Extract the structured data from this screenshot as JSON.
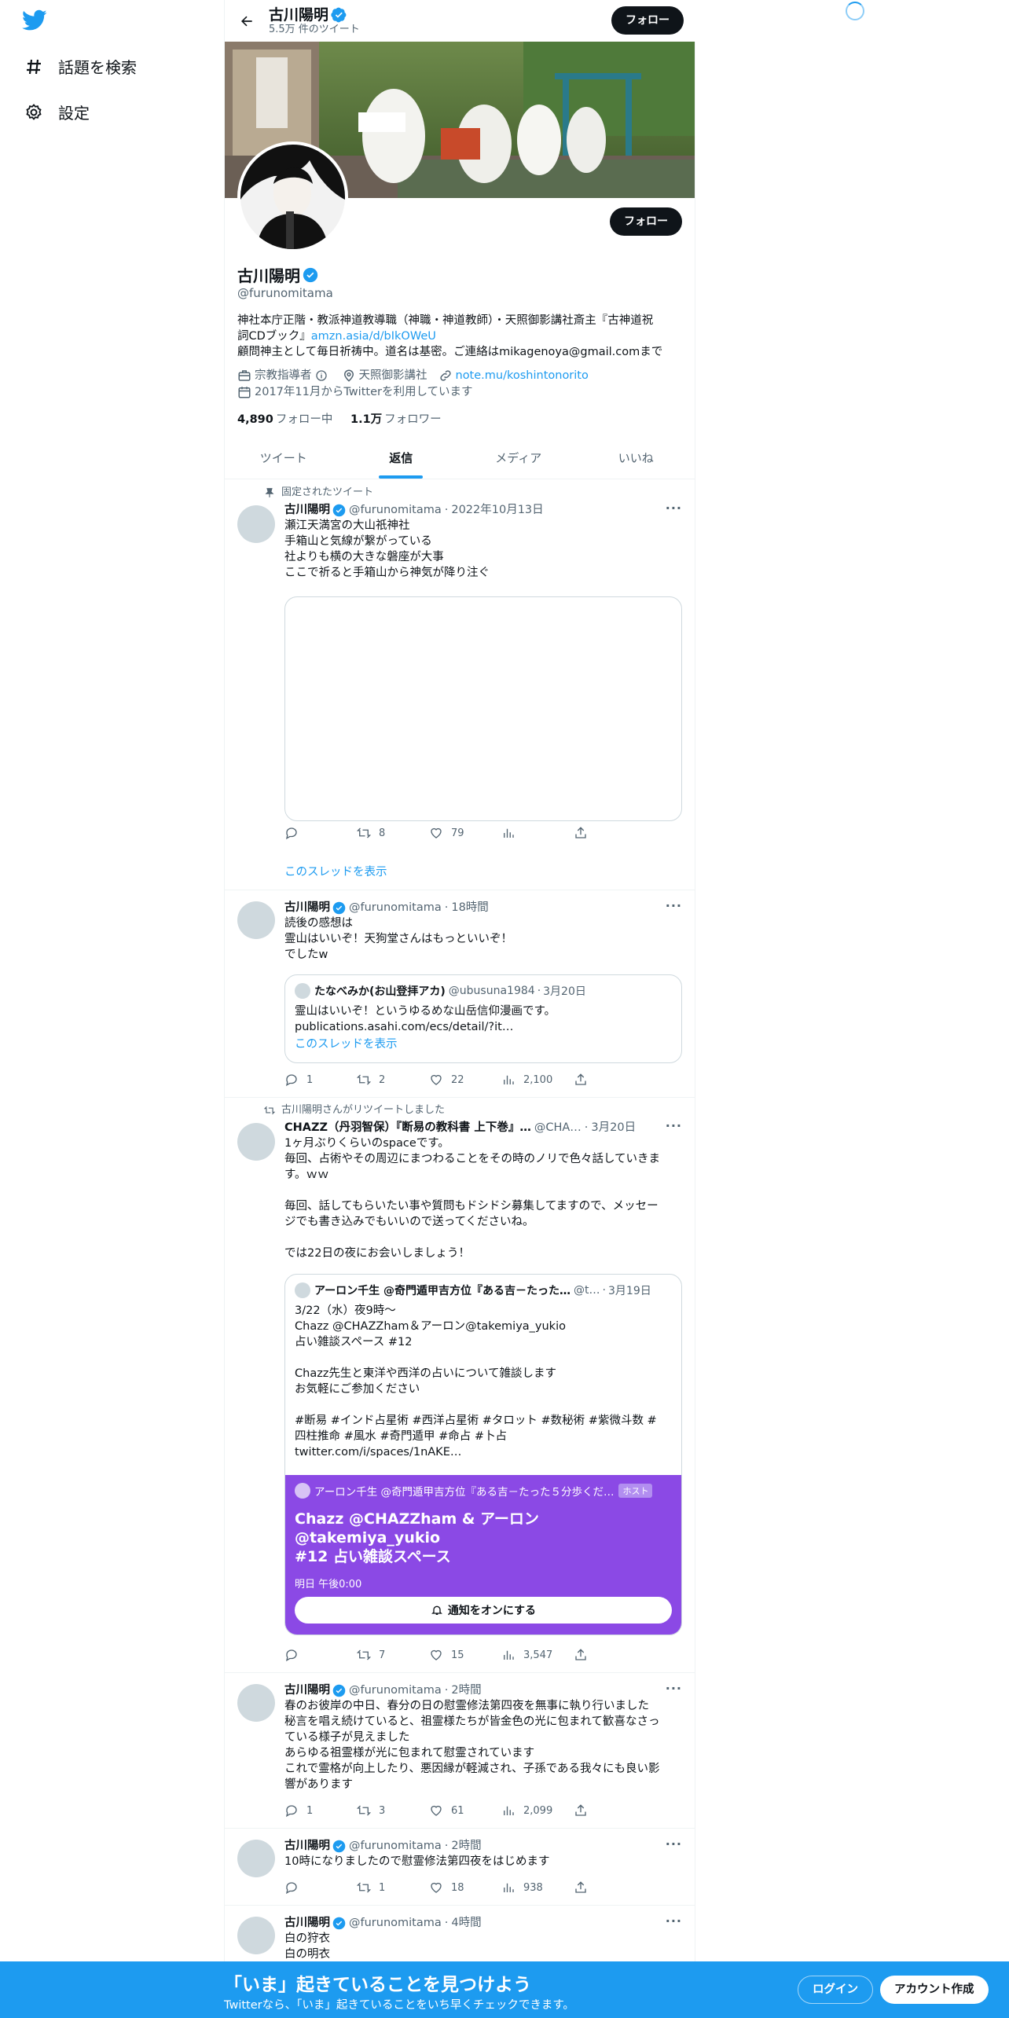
{
  "nav": {
    "explore": "話題を検索",
    "settings": "設定"
  },
  "header": {
    "name": "古川陽明",
    "tweet_count": "5.5万 件のツイート",
    "follow": "フォロー"
  },
  "profile": {
    "name": "古川陽明",
    "handle": "@furunomitama",
    "follow": "フォロー",
    "bio_line1": "神社本庁正階・教派神道教導職（神職・神道教師）・天照御影講社斎主『古神道祝",
    "bio_line2_prefix": "詞CDブック』",
    "bio_link": "amzn.asia/d/bIkOWeU",
    "bio_line3": "顧問神主として毎日祈祷中。道名は基密。ご連絡はmikagenoya@gmail.comまで",
    "category": "宗教指導者",
    "location": "天照御影講社",
    "website": "note.mu/koshintonorito",
    "joined": "2017年11月からTwitterを利用しています",
    "following_count": "4,890",
    "following_label": "フォロー中",
    "followers_count": "1.1万",
    "followers_label": "フォロワー"
  },
  "tabs": [
    "ツイート",
    "返信",
    "メディア",
    "いいね"
  ],
  "tweets": [
    {
      "social": "固定されたツイート",
      "name": "古川陽明",
      "handle": "@furunomitama",
      "time": "2022年10月13日",
      "text": "瀬江天満宮の大山祇神社\n手箱山と気線が繋がっている\n社よりも横の大きな磐座が大事\nここで祈ると手箱山から神気が降り注ぐ",
      "retweets": "8",
      "likes": "79",
      "views": "",
      "thread_link": "このスレッドを表示"
    },
    {
      "name": "古川陽明",
      "handle": "@furunomitama",
      "time": "18時間",
      "text": "読後の感想は\n霊山はいいぞ！天狗堂さんはもっといいぞ！\nでしたw",
      "quote": {
        "name": "たなべみか(お山登拝アカ)",
        "handle": "@ubusuna1984",
        "time": "3月20日",
        "text": "霊山はいいぞ！というゆるめな山岳信仰漫画です。\npublications.asahi.com/ecs/detail/?it…",
        "link": "このスレッドを表示"
      },
      "replies": "1",
      "retweets": "2",
      "likes": "22",
      "views": "2,100"
    },
    {
      "social": "古川陽明さんがリツイートしました",
      "name": "CHAZZ（丹羽智保）『断易の教科書 上下巻』…",
      "handle": "@CHA…",
      "time": "3月20日",
      "text": "1ヶ月ぶりくらいのspaceです。\n毎回、占術やその周辺にまつわることをその時のノリで色々話していきま\nす。ｗｗ\n\n毎回、話してもらいたい事や質問もドシドシ募集してますので、メッセー\nジでも書き込みでもいいので送ってくださいね。\n\nでは22日の夜にお会いしましょう！",
      "quote": {
        "name": "アーロン千生 @奇門遁甲吉方位『ある吉－たった…",
        "handle": "@t…",
        "time": "3月19日",
        "text": "3/22（水）夜9時～\nChazz @CHAZZham＆アーロン@takemiya_yukio\n占い雑談スペース #12\n\nChazz先生と東洋や西洋の占いについて雑談します\nお気軽にご参加ください\n\n#断易 #インド占星術 #西洋占星術 #タロット #数秘術 #紫微斗数 #\n四柱推命 #風水 #奇門遁甲 #命占 #卜占\ntwitter.com/i/spaces/1nAKE…"
      },
      "space": {
        "host": "アーロン千生 @奇門遁甲吉方位『ある吉－たった５分歩くだ…",
        "badge": "ホスト",
        "title": "Chazz @CHAZZham & アーロン@takemiya_yukio\n#12 占い雑談スペース",
        "time": "明日 午後0:00",
        "button": "通知をオンにする"
      },
      "replies": "",
      "retweets": "7",
      "likes": "15",
      "views": "3,547"
    },
    {
      "name": "古川陽明",
      "handle": "@furunomitama",
      "time": "2時間",
      "text": "春のお彼岸の中日、春分の日の慰霊修法第四夜を無事に執り行いました\n秘言を唱え続けていると、祖霊様たちが皆金色の光に包まれて歓喜なさっ\nている様子が見えました\nあらゆる祖霊様が光に包まれて慰霊されています\nこれで霊格が向上したり、悪因縁が軽減され、子孫である我々にも良い影\n響があります",
      "replies": "1",
      "retweets": "3",
      "likes": "61",
      "views": "2,099"
    },
    {
      "name": "古川陽明",
      "handle": "@furunomitama",
      "time": "2時間",
      "text": "10時になりましたので慰霊修法第四夜をはじめます",
      "replies": "",
      "retweets": "1",
      "likes": "18",
      "views": "938"
    },
    {
      "name": "古川陽明",
      "handle": "@furunomitama",
      "time": "4時間",
      "text": "白の狩衣\n白の明衣"
    }
  ],
  "bottom": {
    "title": "「いま」起きていることを見つけよう",
    "subtitle": "Twitterなら、「いま」起きていることをいち早くチェックできます。",
    "login": "ログイン",
    "signup": "アカウント作成"
  },
  "colors": {
    "accent": "#1d9bf0",
    "space": "#8b49e5",
    "text": "#0f1419",
    "muted": "#536471"
  }
}
